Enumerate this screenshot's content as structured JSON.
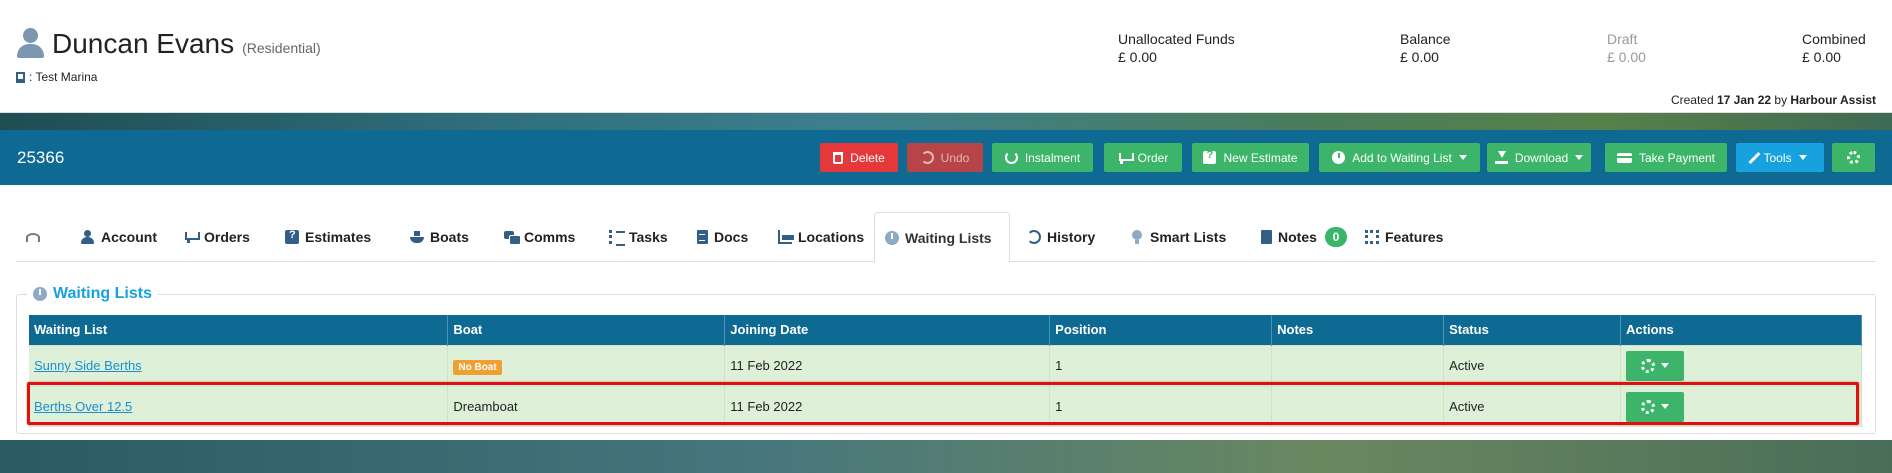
{
  "customer": {
    "name": "Duncan Evans",
    "type": "(Residential)",
    "marina": ": Test Marina"
  },
  "funds": {
    "unallocated_label": "Unallocated Funds",
    "unallocated_value": "£ 0.00",
    "balance_label": "Balance",
    "balance_value": "£ 0.00",
    "draft_label": "Draft",
    "draft_value": "£ 0.00",
    "combined_label": "Combined",
    "combined_value": "£ 0.00"
  },
  "created": {
    "prefix": "Created",
    "date": "17 Jan 22",
    "by": "by",
    "author": "Harbour Assist"
  },
  "toolbar": {
    "record_id": "25366",
    "delete": "Delete",
    "undo": "Undo",
    "instalment": "Instalment",
    "order": "Order",
    "new_estimate": "New Estimate",
    "add_waiting": "Add to Waiting List",
    "download": "Download",
    "take_payment": "Take Payment",
    "tools": "Tools"
  },
  "tabs": {
    "account": "Account",
    "orders": "Orders",
    "estimates": "Estimates",
    "boats": "Boats",
    "comms": "Comms",
    "tasks": "Tasks",
    "docs": "Docs",
    "locations": "Locations",
    "waiting_lists": "Waiting Lists",
    "history": "History",
    "smart_lists": "Smart Lists",
    "notes": "Notes",
    "notes_count": "0",
    "features": "Features"
  },
  "section": {
    "title": "Waiting Lists"
  },
  "table": {
    "headers": [
      "Waiting List",
      "Boat",
      "Joining Date",
      "Position",
      "Notes",
      "Status",
      "Actions"
    ],
    "rows": [
      {
        "waiting_list": "Sunny Side Berths",
        "boat": "No Boat",
        "joining_date": "11 Feb 2022",
        "position": "1",
        "notes": "",
        "status": "Active"
      },
      {
        "waiting_list": "Berths Over 12.5",
        "boat": "Dreamboat",
        "joining_date": "11 Feb 2022",
        "position": "1",
        "notes": "",
        "status": "Active"
      }
    ]
  },
  "colors": {
    "primary_bar": "#0e6a93",
    "success": "#3cb56a",
    "danger": "#e5383b",
    "info": "#17a1de",
    "warning": "#f0a030",
    "highlight_outline": "#dd1111"
  }
}
